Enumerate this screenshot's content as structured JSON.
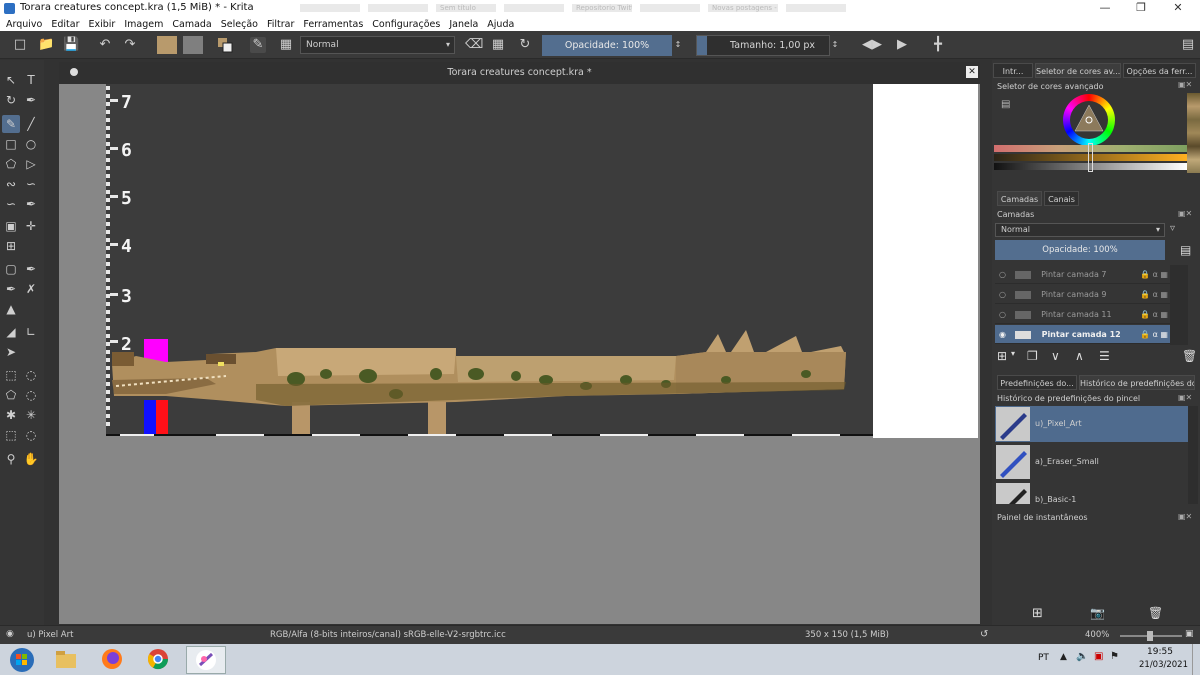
{
  "window": {
    "title": "Torara creatures concept.kra (1,5 MiB)  * - Krita",
    "ghost_tabs": [
      "",
      "",
      "Sem título",
      "",
      "Repositorio Twitter",
      "",
      "Novas postagens - Torara",
      ""
    ]
  },
  "menu": [
    "Arquivo",
    "Editar",
    "Exibir",
    "Imagem",
    "Camada",
    "Seleção",
    "Filtrar",
    "Ferramentas",
    "Configurações",
    "Janela",
    "Ajuda"
  ],
  "toolbar": {
    "blend_mode": "Normal",
    "opacity_label": "Opacidade: 100%",
    "size_label": "Tamanho: 1,00 px",
    "fg_color": "#b89a6c",
    "bg_color": "#7f7f7f"
  },
  "document": {
    "tab_title": "Torara creatures concept.kra *",
    "ruler_numbers": [
      "7",
      "6",
      "5",
      "4",
      "3",
      "2"
    ]
  },
  "dock": {
    "top_tabs": [
      "Intr...",
      "Seletor de cores av...",
      "Opções da ferr..."
    ],
    "color_selector_title": "Seletor de cores avançado",
    "layers_tabs": [
      "Camadas",
      "Canais"
    ],
    "layers_title": "Camadas",
    "layers_blend": "Normal",
    "layers_opacity": "Opacidade:  100%",
    "layers": [
      {
        "name": "Pintar camada 7",
        "selected": false
      },
      {
        "name": "Pintar camada 9",
        "selected": false
      },
      {
        "name": "Pintar camada 11",
        "selected": false
      },
      {
        "name": "Pintar camada 12",
        "selected": true
      }
    ],
    "preset_tabs": [
      "Predefinições do...",
      "Histórico de predefinições do ..."
    ],
    "preset_history_title": "Histórico de predefinições do pincel",
    "brushes": [
      {
        "name": "u)_Pixel_Art",
        "selected": true
      },
      {
        "name": "a)_Eraser_Small",
        "selected": false
      },
      {
        "name": "b)_Basic-1",
        "selected": false
      }
    ],
    "snapshot_title": "Painel de instantâneos"
  },
  "status": {
    "brush": "u) Pixel Art",
    "color_space": "RGB/Alfa (8-bits inteiros/canal)  sRGB-elle-V2-srgbtrc.icc",
    "dimensions": "350 x 150 (1,5 MiB)",
    "zoom": "400%"
  },
  "taskbar": {
    "lang": "PT",
    "time": "19:55",
    "date": "21/03/2021"
  }
}
